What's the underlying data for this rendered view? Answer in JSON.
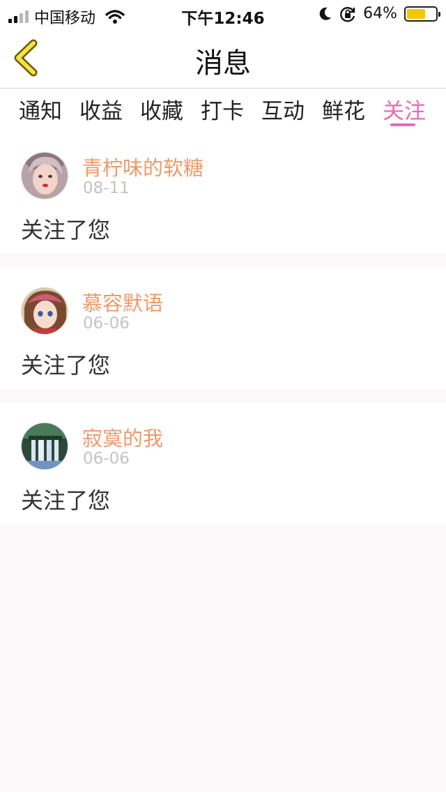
{
  "status_bar": {
    "carrier": "中国移动",
    "time": "下午12:46",
    "battery_percent_label": "64%",
    "battery_level": 0.64,
    "battery_color": "#f6c800"
  },
  "nav": {
    "title": "消息",
    "back_icon": "chevron-left-icon"
  },
  "tabs": [
    {
      "label": "通知",
      "active": false
    },
    {
      "label": "收益",
      "active": false
    },
    {
      "label": "收藏",
      "active": false
    },
    {
      "label": "打卡",
      "active": false
    },
    {
      "label": "互动",
      "active": false
    },
    {
      "label": "鲜花",
      "active": false
    },
    {
      "label": "关注",
      "active": true
    }
  ],
  "accent_color": "#e86bb0",
  "username_color": "#ef9a6a",
  "messages": [
    {
      "username": "青柠味的软糖",
      "date": "08-11",
      "text": "关注了您"
    },
    {
      "username": "慕容默语",
      "date": "06-06",
      "text": "关注了您"
    },
    {
      "username": "寂寞的我",
      "date": "06-06",
      "text": "关注了您"
    }
  ]
}
